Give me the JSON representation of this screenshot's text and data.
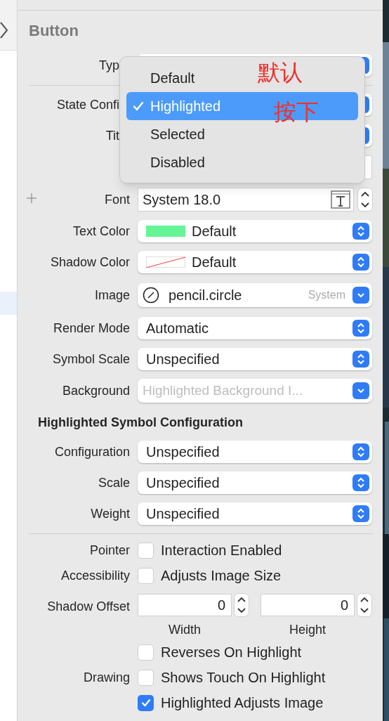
{
  "header": "Button",
  "rows": [
    {
      "kind": "popup",
      "label": "Typ",
      "covered": true
    },
    {
      "kind": "divider"
    },
    {
      "kind": "popup",
      "label": "State Confi",
      "covered": true
    },
    {
      "kind": "popup",
      "label": "Tit",
      "covered": true
    },
    {
      "kind": "field"
    },
    {
      "kind": "font",
      "label": "Font",
      "value": "System 18.0"
    },
    {
      "kind": "color",
      "label": "Text Color",
      "value": "Default",
      "clear": false,
      "color": "#66f594"
    },
    {
      "kind": "color",
      "label": "Shadow Color",
      "value": "Default",
      "clear": true
    },
    {
      "label": "Image",
      "value": "pencil.circle",
      "source": "System"
    },
    {
      "kind": "popup",
      "label": "Render Mode",
      "value": "Automatic"
    },
    {
      "kind": "popup",
      "label": "Symbol Scale",
      "value": "Unspecified"
    },
    {
      "kind": "combo",
      "label": "Background",
      "placeholder": "Highlighted Background I..."
    },
    {
      "kind": "section",
      "label": "Highlighted Symbol Configuration"
    },
    {
      "kind": "popup",
      "label": "Configuration",
      "value": "Unspecified"
    },
    {
      "kind": "popup",
      "label": "Scale",
      "value": "Unspecified"
    },
    {
      "kind": "popup",
      "label": "Weight",
      "value": "Unspecified"
    },
    {
      "kind": "divider"
    },
    {
      "kind": "checkbox",
      "label": "Pointer",
      "text": "Interaction Enabled",
      "checked": false
    },
    {
      "kind": "checkbox",
      "label": "Accessibility",
      "text": "Adjusts Image Size",
      "checked": false
    },
    {
      "kind": "offset",
      "label": "Shadow Offset",
      "fields": [
        {
          "value": "0",
          "caption": "Width"
        },
        {
          "value": "0",
          "caption": "Height"
        }
      ]
    },
    {
      "kind": "checkbox",
      "text": "Reverses On Highlight",
      "checked": false
    },
    {
      "kind": "checkbox",
      "label": "Drawing",
      "text": "Shows Touch On Highlight",
      "checked": false
    },
    {
      "kind": "checkbox",
      "text": "Highlighted Adjusts Image",
      "checked": true
    }
  ],
  "menu": {
    "items": [
      {
        "label": "Default",
        "selected": false
      },
      {
        "label": "Highlighted",
        "selected": true
      },
      {
        "label": "Selected",
        "selected": false
      },
      {
        "label": "Disabled",
        "selected": false
      }
    ]
  },
  "annotations": [
    "默认",
    "按下"
  ]
}
